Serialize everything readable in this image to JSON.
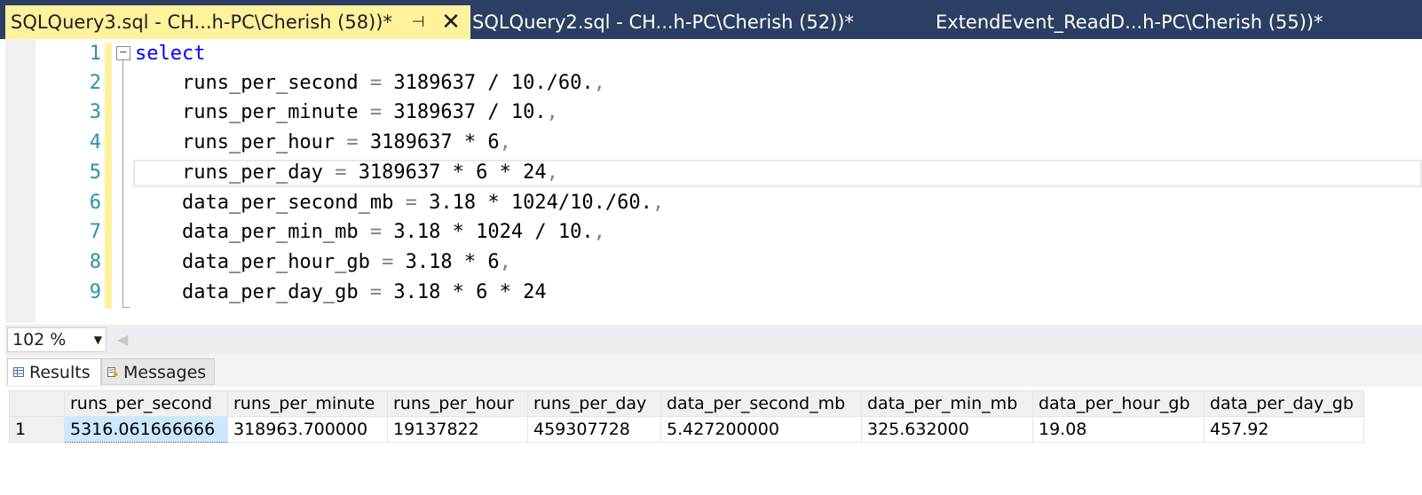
{
  "tabs": [
    {
      "title": "SQLQuery3.sql - CH...h-PC\\Cherish (58))*",
      "active": true
    },
    {
      "title": "SQLQuery2.sql - CH...h-PC\\Cherish (52))*",
      "active": false
    },
    {
      "title": "ExtendEvent_ReadD...h-PC\\Cherish (55))*",
      "active": false
    }
  ],
  "tab_icons": {
    "pin": "pin-icon",
    "close": "close-icon"
  },
  "editor": {
    "fold_symbol": "−",
    "lines": [
      {
        "n": "1",
        "keyword": "select",
        "name": "",
        "eq": "",
        "expr": "",
        "comma": ""
      },
      {
        "n": "2",
        "keyword": "",
        "name": "runs_per_second",
        "eq": "=",
        "expr": "3189637 / 10./60.",
        "comma": ","
      },
      {
        "n": "3",
        "keyword": "",
        "name": "runs_per_minute",
        "eq": "=",
        "expr": "3189637 / 10.",
        "comma": ","
      },
      {
        "n": "4",
        "keyword": "",
        "name": "runs_per_hour",
        "eq": "=",
        "expr": "3189637 * 6",
        "comma": ","
      },
      {
        "n": "5",
        "keyword": "",
        "name": "runs_per_day",
        "eq": "=",
        "expr": "3189637 * 6 * 24",
        "comma": ","
      },
      {
        "n": "6",
        "keyword": "",
        "name": "data_per_second_mb",
        "eq": "=",
        "expr": "3.18 * 1024/10./60.",
        "comma": ","
      },
      {
        "n": "7",
        "keyword": "",
        "name": "data_per_min_mb",
        "eq": "=",
        "expr": "3.18 * 1024 / 10.",
        "comma": ","
      },
      {
        "n": "8",
        "keyword": "",
        "name": "data_per_hour_gb",
        "eq": "=",
        "expr": "3.18 * 6",
        "comma": ","
      },
      {
        "n": "9",
        "keyword": "",
        "name": "data_per_day_gb",
        "eq": "=",
        "expr": "3.18 * 6 * 24",
        "comma": ""
      }
    ]
  },
  "zoom": {
    "value": "102 %",
    "arrow": "▼",
    "scroll_left": "◀"
  },
  "results_tabs": {
    "results": "Results",
    "messages": "Messages"
  },
  "grid": {
    "columns": [
      "runs_per_second",
      "runs_per_minute",
      "runs_per_hour",
      "runs_per_day",
      "data_per_second_mb",
      "data_per_min_mb",
      "data_per_hour_gb",
      "data_per_day_gb"
    ],
    "rows": [
      {
        "num": "1",
        "cells": [
          "5316.061666666",
          "318963.700000",
          "19137822",
          "459307728",
          "5.427200000",
          "325.632000",
          "19.08",
          "457.92"
        ]
      }
    ]
  },
  "colors": {
    "tab_strip": "#2b3e63",
    "active_tab": "#fff29d",
    "keyword": "#0000ff",
    "operator": "#808080",
    "line_number": "#2b91af",
    "selected_cell": "#cce8ff"
  }
}
